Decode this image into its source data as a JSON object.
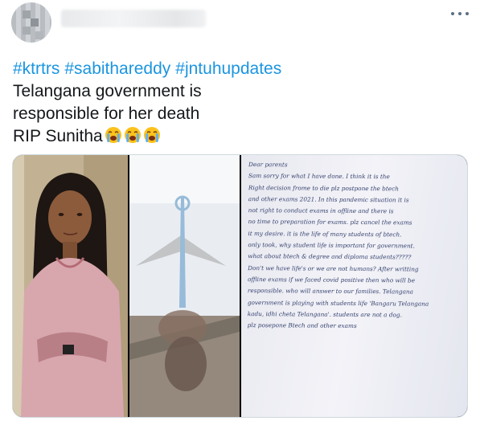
{
  "tweet": {
    "hashtags": [
      "#ktrtrs",
      "#sabithareddy",
      "#jntuhupdates"
    ],
    "lines": [
      "Telangana government is",
      "responsible for her death",
      "RIP Sunitha"
    ],
    "emoji": [
      "loudly-crying-face",
      "loudly-crying-face",
      "loudly-crying-face"
    ]
  },
  "media": {
    "note_lines": [
      "Dear parents",
      "Sam sorry for what I have done. I think it is the",
      "Right decision frome to die plz postpone the btech",
      "and other exams 2021. In this pandemic situation it is",
      "not right to conduct exams in offline and there is",
      "no time to preparation for exams. plz cancel the exams",
      "it my desire. it is the life of many students of btech.",
      "only took, why student life is important for government.",
      "what about btech & degree and diploma students?????",
      "Don't we have life's or we are not humans? After writting",
      "offline exams if we faced covid positive then who will be",
      "responsible. who will answer to our families. Telangana",
      "government is playing with students life 'Bangaru Telangana",
      "kadu, idhi cheta Telangana'. students are not a dog.",
      "",
      "plz posepone Btech and other exams"
    ]
  },
  "colors": {
    "hashtag": "#1b95e0",
    "text": "#14171a",
    "icon": "#5b7083",
    "ink": "#34406e"
  }
}
